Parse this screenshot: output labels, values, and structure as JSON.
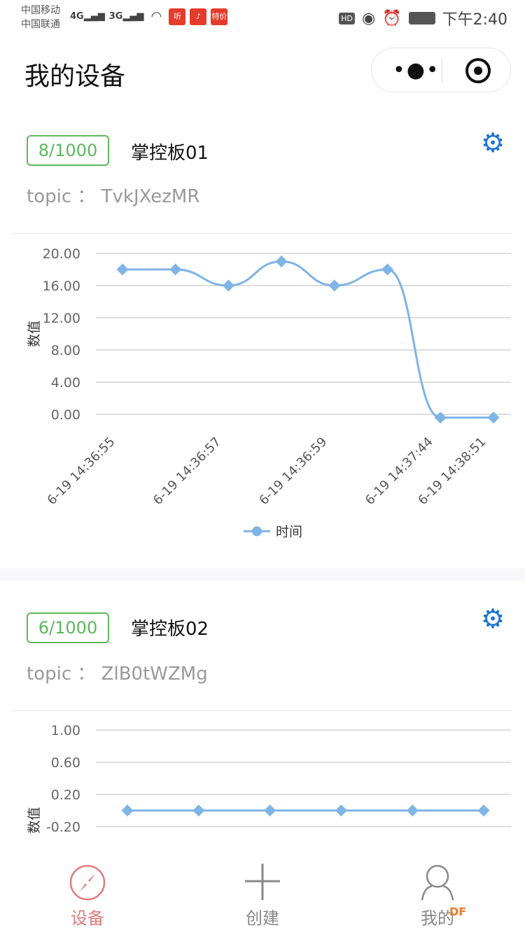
{
  "status_bar": {
    "carrier1": "中国移动",
    "carrier2": "中国联通",
    "net1": "4G",
    "net2": "3G",
    "app_icons": [
      "听",
      "特价"
    ],
    "hd": "HD",
    "time": "下午2:40"
  },
  "nav": {
    "title": "我的设备",
    "more_icon": "more-dots-icon",
    "target_icon": "record-target-icon"
  },
  "devices": [
    {
      "count": "8/1000",
      "name": "掌控板01",
      "topic_label": "topic ：",
      "topic": "TvkJXezMR"
    },
    {
      "count": "6/1000",
      "name": "掌控板02",
      "topic_label": "topic ：",
      "topic": "ZlB0tWZMg"
    }
  ],
  "chart_data": [
    {
      "type": "line",
      "ylabel": "数值",
      "legend": "时间",
      "legend_position": "bottom",
      "color": "#7eb4e6",
      "grid": true,
      "y_ticks": [
        "20.00",
        "16.00",
        "12.00",
        "8.00",
        "4.00",
        "0.00"
      ],
      "ylim": [
        0,
        20
      ],
      "x_labels": [
        "6-19 14:36:55",
        "",
        "6-19 14:36:57",
        "",
        "6-19 14:36:59",
        "",
        "6-19 14:37:44",
        "6-19 14:38:51"
      ],
      "values": [
        18,
        18,
        16,
        19,
        16,
        18,
        -0.4,
        -0.4
      ]
    },
    {
      "type": "line",
      "ylabel": "数值",
      "color": "#7eb4e6",
      "grid": true,
      "y_ticks": [
        "1.00",
        "0.60",
        "0.20",
        "-0.20"
      ],
      "ylim": [
        -0.2,
        1
      ],
      "values": [
        0,
        0,
        0,
        0,
        0,
        0
      ]
    }
  ],
  "tabbar": {
    "items": [
      {
        "label": "设备",
        "active": true,
        "color": "#e07b7b"
      },
      {
        "label": "创建"
      },
      {
        "label": "我的"
      }
    ],
    "watermark": "DF"
  }
}
